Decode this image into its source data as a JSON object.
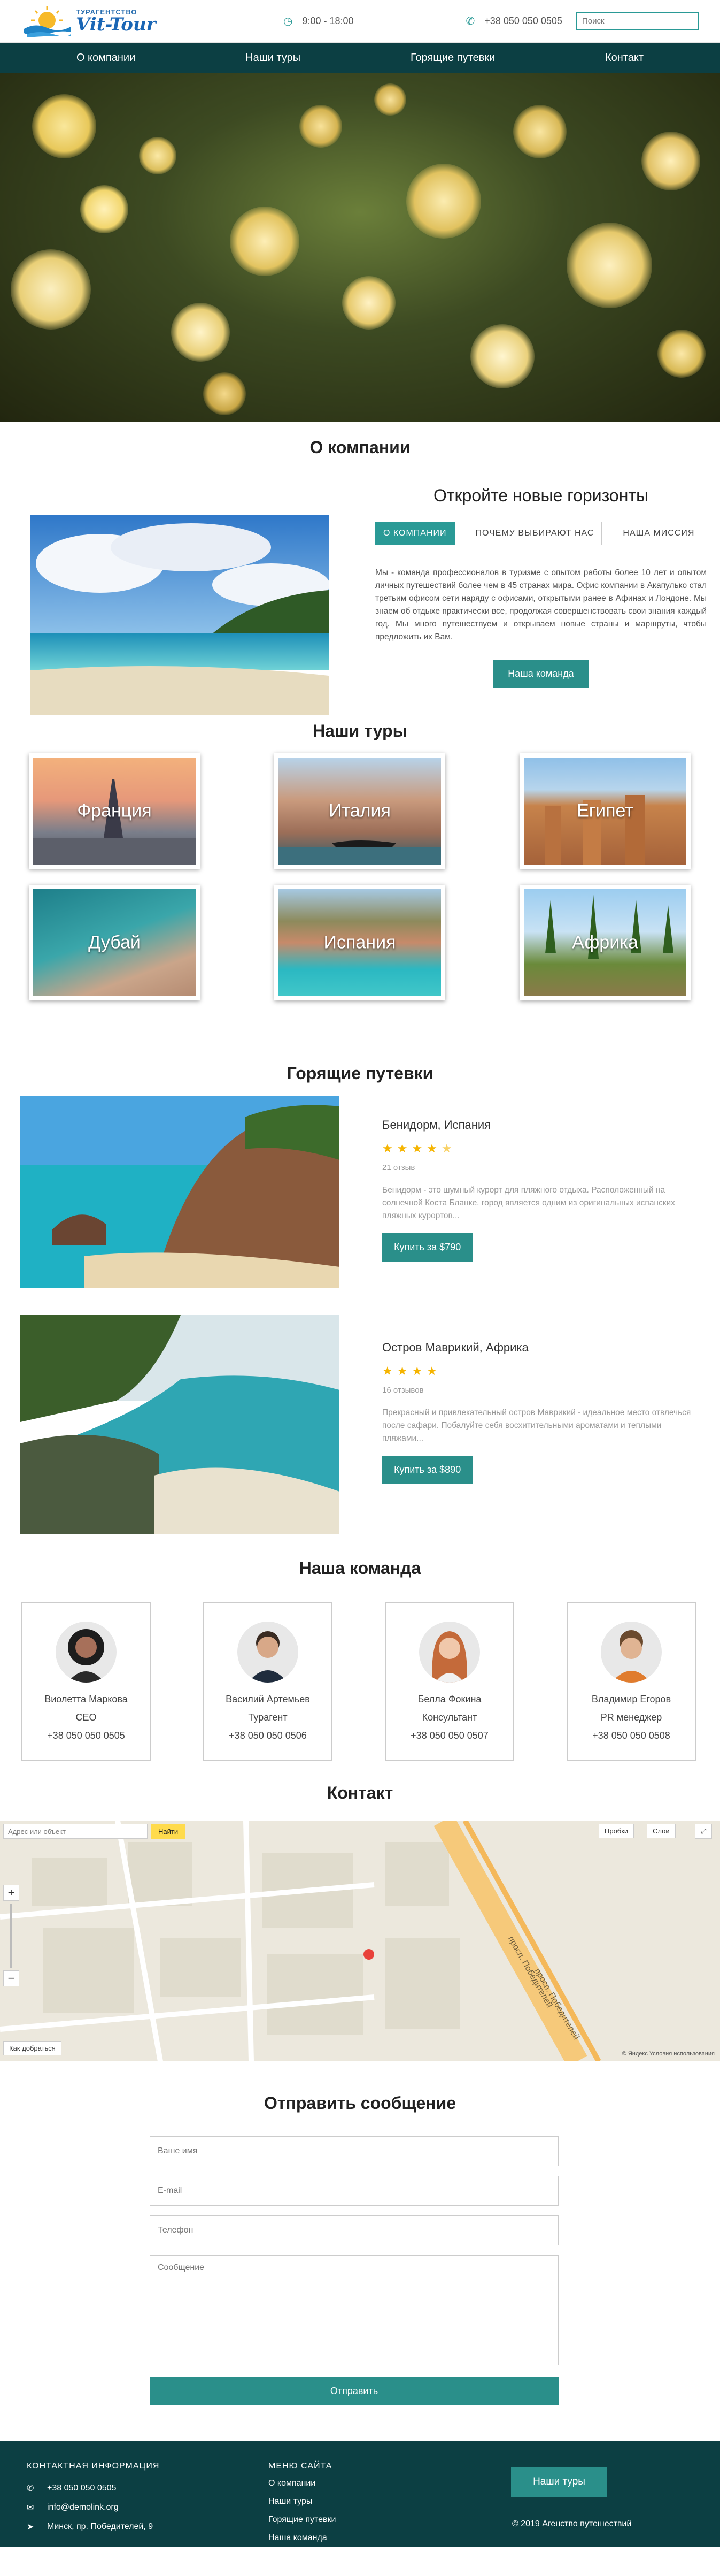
{
  "header": {
    "logo_sub": "ТУРАГЕНТСТВО",
    "logo_main": "Vit-Tour",
    "hours": "9:00 - 18:00",
    "phone": "+38 050 050 0505",
    "search_placeholder": "Поиск"
  },
  "nav": {
    "items": [
      "О компании",
      "Наши туры",
      "Горящие путевки",
      "Контакт"
    ]
  },
  "about": {
    "title": "О компании",
    "subtitle": "Откройте новые горизонты",
    "tabs": [
      "О КОМПАНИИ",
      "ПОЧЕМУ ВЫБИРАЮТ НАС",
      "НАША МИССИЯ"
    ],
    "text": "Мы - команда профессионалов в туризме с опытом работы более 10 лет и опытом личных путешествий более чем в 45 странах мира. Офис компании в Акапулько стал третьим офисом сети наряду с офисами, открытыми ранее в Афинах и Лондоне. Мы знаем об отдыхе практически все, продолжая совершенствовать свои знания каждый год. Мы много путешествуем и открываем новые страны и маршруты, чтобы предложить их Вам.",
    "button": "Наша команда"
  },
  "tours": {
    "title": "Наши туры",
    "items": [
      "Франция",
      "Италия",
      "Египет",
      "Дубай",
      "Испания",
      "Африка"
    ]
  },
  "hot": {
    "title": "Горящие путевки",
    "items": [
      {
        "name": "Бенидорм, Испания",
        "rating": 4.5,
        "reviews": "21 отзыв",
        "desc": "Бенидорм - это шумный курорт для пляжного отдыха. Расположенный на солнечной Коста Бланке, город является одним из оригинальных испанских пляжных курортов...",
        "button": "Купить за $790"
      },
      {
        "name": "Остров Маврикий, Африка",
        "rating": 4,
        "reviews": "16 отзывов",
        "desc": "Прекрасный и привлекательный остров Маврикий - идеальное место отвлечься после сафари. Побалуйте себя восхитительными ароматами и теплыми пляжами...",
        "button": "Купить за $890"
      }
    ]
  },
  "team": {
    "title": "Наша команда",
    "members": [
      {
        "name": "Виолетта Маркова",
        "role": "CEO",
        "phone": "+38 050 050 0505"
      },
      {
        "name": "Василий Артемьев",
        "role": "Турагент",
        "phone": "+38 050 050 0506"
      },
      {
        "name": "Белла Фокина",
        "role": "Консультант",
        "phone": "+38 050 050 0507"
      },
      {
        "name": "Владимир Егоров",
        "role": "PR менеджер",
        "phone": "+38 050 050 0508"
      }
    ]
  },
  "contact": {
    "title": "Контакт",
    "map_search_placeholder": "Адрес или объект",
    "map_find": "Найти",
    "map_traffic": "Пробки",
    "map_layers": "Слои",
    "map_route": "Как добраться",
    "map_copyright": "© Яндекс  Условия использования",
    "street_labels": [
      "просп. Победителей",
      "просп. Победителей"
    ]
  },
  "form": {
    "title": "Отправить сообщение",
    "name_placeholder": "Ваше имя",
    "email_placeholder": "E-mail",
    "phone_placeholder": "Телефон",
    "message_placeholder": "Сообщение",
    "submit": "Отправить"
  },
  "footer": {
    "contact_title": "КОНТАКТНАЯ ИНФОРМАЦИЯ",
    "phone": "+38 050 050 0505",
    "email": "info@demolink.org",
    "address": "Минск, пр. Победителей, 9",
    "menu_title": "МЕНЮ САЙТА",
    "menu": [
      "О компании",
      "Наши туры",
      "Горящие путевки",
      "Наша команда"
    ],
    "button": "Наши туры",
    "copyright": "© 2019 Агенство путешествий"
  },
  "colors": {
    "accent": "#2a8f8a",
    "nav": "#0c3f43",
    "star": "#f5b400"
  }
}
